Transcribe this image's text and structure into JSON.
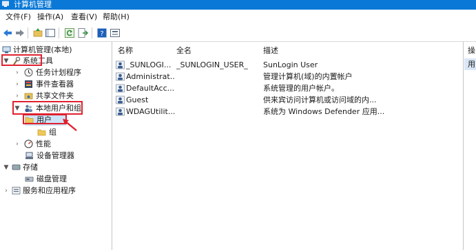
{
  "window": {
    "title": "计算机管理"
  },
  "menu": [
    {
      "label": "文件(F)"
    },
    {
      "label": "操作(A)"
    },
    {
      "label": "查看(V)"
    },
    {
      "label": "帮助(H)"
    }
  ],
  "toolbar": {
    "buttons": [
      "back-arrow-icon",
      "forward-arrow-icon",
      "up-folder-icon",
      "show-hide-tree-icon",
      "refresh-icon",
      "export-list-icon",
      "help-icon",
      "properties-icon"
    ]
  },
  "tree": [
    {
      "label": "计算机管理(本地)",
      "expanded": true,
      "icon": "computer-management-icon"
    },
    {
      "label": "系统工具",
      "expanded": true,
      "icon": "tools-icon"
    },
    {
      "label": "任务计划程序",
      "expanded": false,
      "icon": "clock-icon"
    },
    {
      "label": "事件查看器",
      "expanded": false,
      "icon": "event-viewer-icon"
    },
    {
      "label": "共享文件夹",
      "expanded": false,
      "icon": "shared-folder-icon"
    },
    {
      "label": "本地用户和组",
      "expanded": true,
      "icon": "users-group-icon"
    },
    {
      "label": "用户",
      "selected": true,
      "icon": "folder-icon"
    },
    {
      "label": "组",
      "icon": "folder-icon"
    },
    {
      "label": "性能",
      "expanded": false,
      "icon": "performance-icon"
    },
    {
      "label": "设备管理器",
      "icon": "device-manager-icon"
    },
    {
      "label": "存储",
      "expanded": true,
      "icon": "storage-icon"
    },
    {
      "label": "磁盘管理",
      "icon": "disk-icon"
    },
    {
      "label": "服务和应用程序",
      "expanded": false,
      "icon": "services-icon"
    }
  ],
  "list": {
    "columns": [
      "名称",
      "全名",
      "描述"
    ],
    "rows": [
      {
        "name": "_SUNLOGI...",
        "full_name": "_SUNLOGIN_USER_",
        "description": "SunLogin User"
      },
      {
        "name": "Administrat...",
        "full_name": "",
        "description": "管理计算机(域)的内置帐户"
      },
      {
        "name": "DefaultAcc...",
        "full_name": "",
        "description": "系统管理的用户帐户。"
      },
      {
        "name": "Guest",
        "full_name": "",
        "description": "供来宾访问计算机或访问域的内..."
      },
      {
        "name": "WDAGUtilit...",
        "full_name": "",
        "description": "系统为 Windows Defender 应用..."
      }
    ]
  },
  "actions": {
    "header": "操",
    "item": "用"
  },
  "colors": {
    "title_bar": "#0a78d7",
    "annotation": "#e0202e",
    "selection": "#dbe7f6"
  }
}
